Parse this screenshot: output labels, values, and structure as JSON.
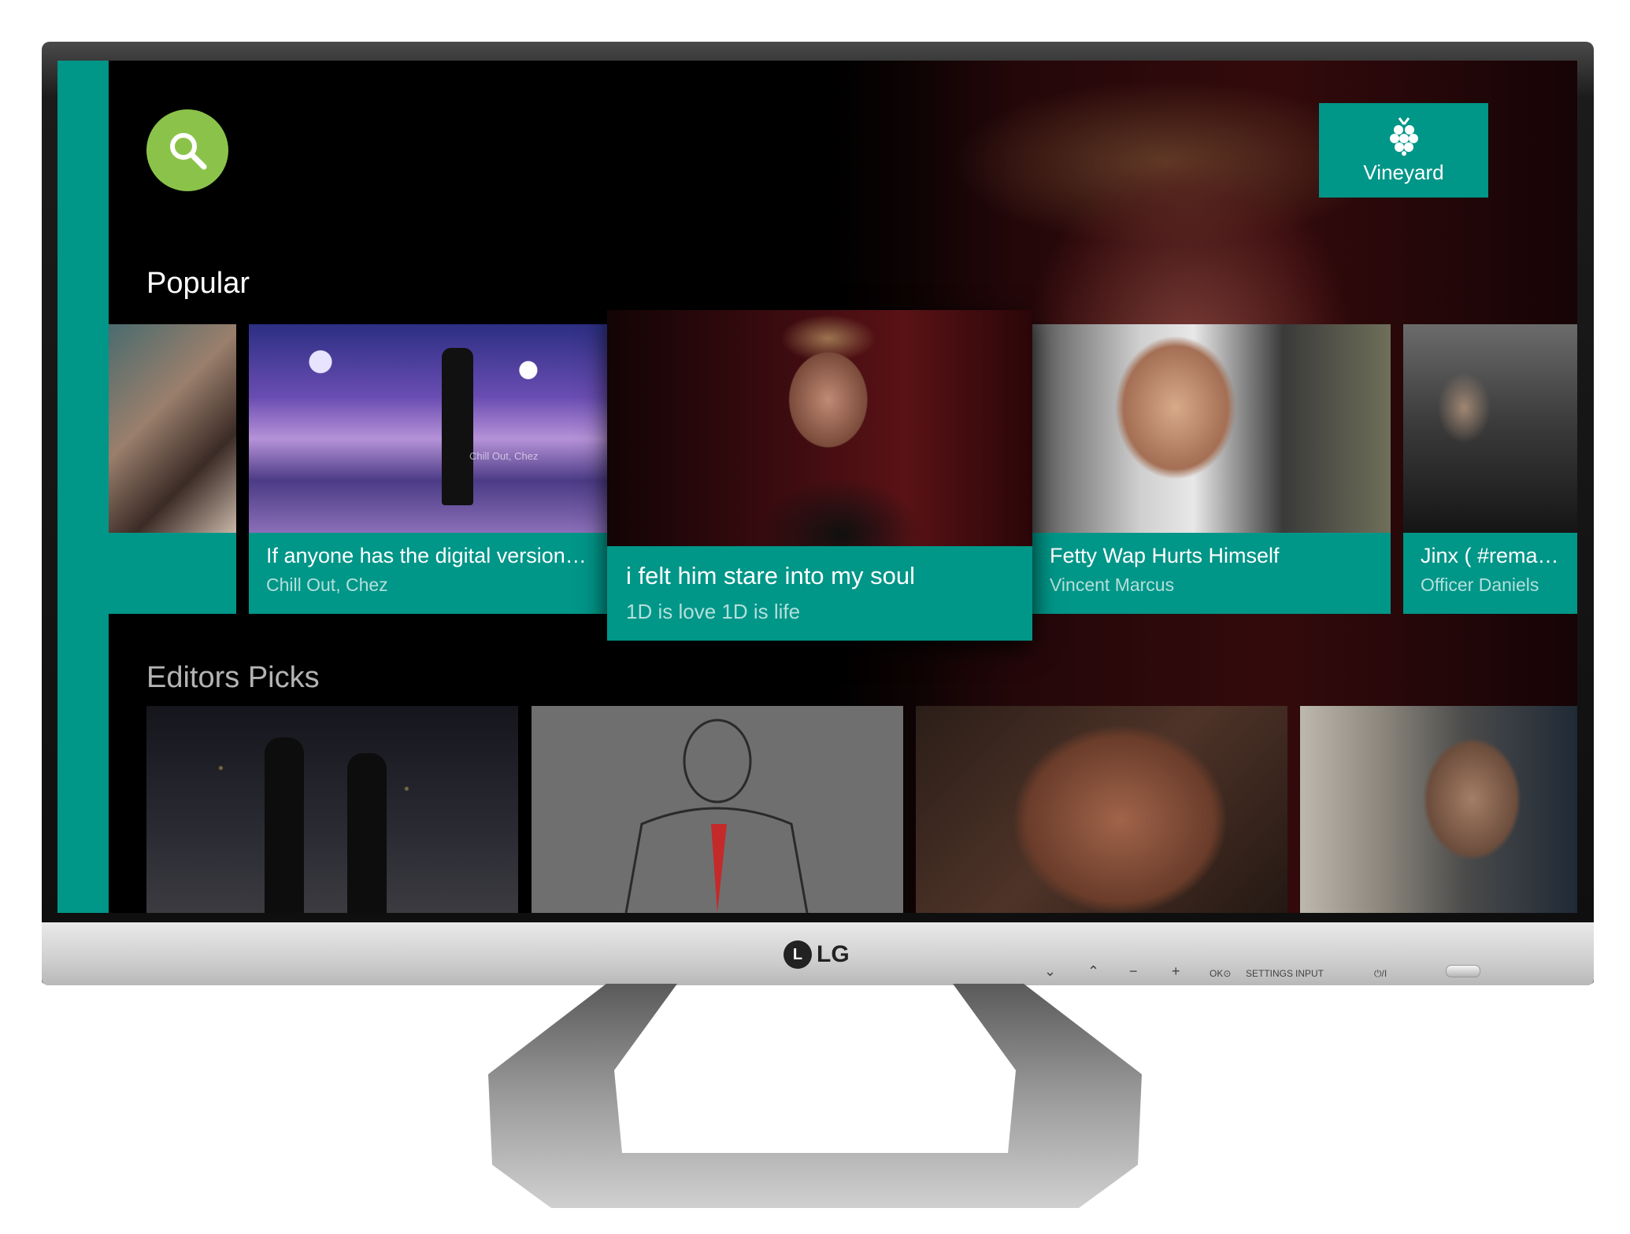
{
  "header": {
    "brand_label": "Vineyard"
  },
  "rows": {
    "popular": "Popular",
    "editors": "Editors Picks"
  },
  "popular_cards": [
    {
      "title": "",
      "subtitle": ""
    },
    {
      "title": "If anyone has the digital version of...",
      "subtitle": "Chill Out, Chez"
    },
    {
      "title": "i felt him stare into my soul",
      "subtitle": "1D is love 1D is life"
    },
    {
      "title": "Fetty Wap Hurts Himself",
      "subtitle": "Vincent Marcus"
    },
    {
      "title": "Jinx ( #remake of",
      "subtitle": "Officer Daniels"
    }
  ],
  "overlay_text": {
    "stage_caption": "Chill Out, Chez"
  },
  "monitor": {
    "brand": "LG",
    "buttons": [
      "⌄",
      "⌃",
      "−",
      "+",
      "OK⊙",
      "SETTINGS",
      "INPUT",
      "⏻/I"
    ]
  },
  "colors": {
    "accent": "#009688",
    "search": "#8bc34a",
    "background": "#000000"
  },
  "icons": [
    "search-icon",
    "grape-icon"
  ]
}
